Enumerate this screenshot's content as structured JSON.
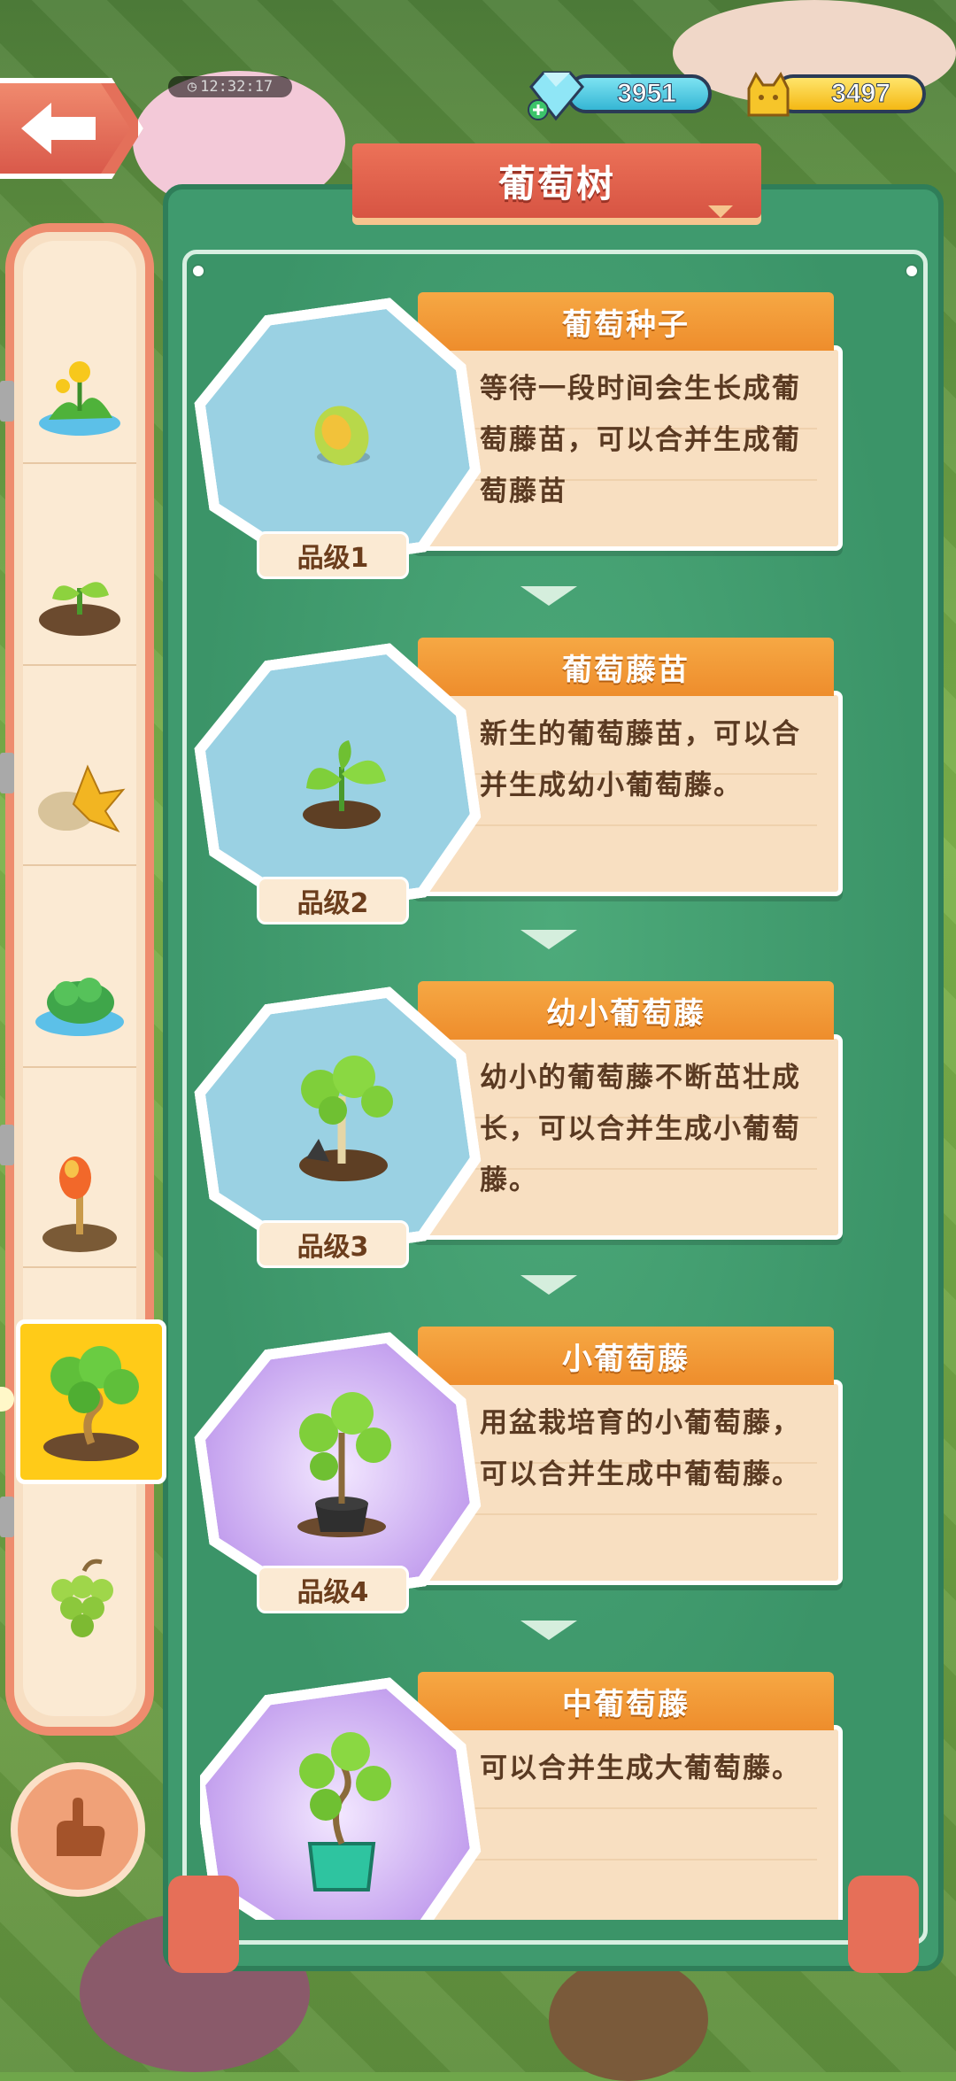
{
  "status": {
    "clock": "12:32:17"
  },
  "currency": {
    "gems": "3951",
    "gold": "3497"
  },
  "panel": {
    "title": "葡萄树"
  },
  "categories": [
    {
      "icon": "yellow-flower-plant-icon",
      "selected": false
    },
    {
      "icon": "seedling-sprout-icon",
      "selected": false
    },
    {
      "icon": "autumn-leaf-rock-icon",
      "selected": false
    },
    {
      "icon": "bush-pond-icon",
      "selected": false
    },
    {
      "icon": "orange-bulb-plant-icon",
      "selected": false
    },
    {
      "icon": "grape-tree-icon",
      "selected": true
    },
    {
      "icon": "green-grapes-icon",
      "selected": false
    }
  ],
  "items": [
    {
      "name": "葡萄种子",
      "description": "等待一段时间会生长成葡萄藤苗，可以合并生成葡萄藤苗",
      "grade": "品级1",
      "bg": "blue",
      "icon": "grape-seed-icon"
    },
    {
      "name": "葡萄藤苗",
      "description": "新生的葡萄藤苗，可以合并生成幼小葡萄藤。",
      "grade": "品级2",
      "bg": "blue",
      "icon": "grape-sprout-icon"
    },
    {
      "name": "幼小葡萄藤",
      "description": "幼小的葡萄藤不断茁壮成长，可以合并生成小葡萄藤。",
      "grade": "品级3",
      "bg": "blue",
      "icon": "young-grapevine-icon"
    },
    {
      "name": "小葡萄藤",
      "description": "用盆栽培育的小葡萄藤，可以合并生成中葡萄藤。",
      "grade": "品级4",
      "bg": "purple",
      "icon": "potted-small-grapevine-icon"
    },
    {
      "name": "中葡萄藤",
      "description": "可以合并生成大葡萄藤。",
      "grade": "",
      "bg": "purple",
      "icon": "medium-grapevine-icon"
    }
  ],
  "colors": {
    "panel": "#3f9a6e",
    "card": "#f8dfc1",
    "tab": "#ee8d2c",
    "title": "#d75443",
    "selected": "#ffcb18"
  }
}
